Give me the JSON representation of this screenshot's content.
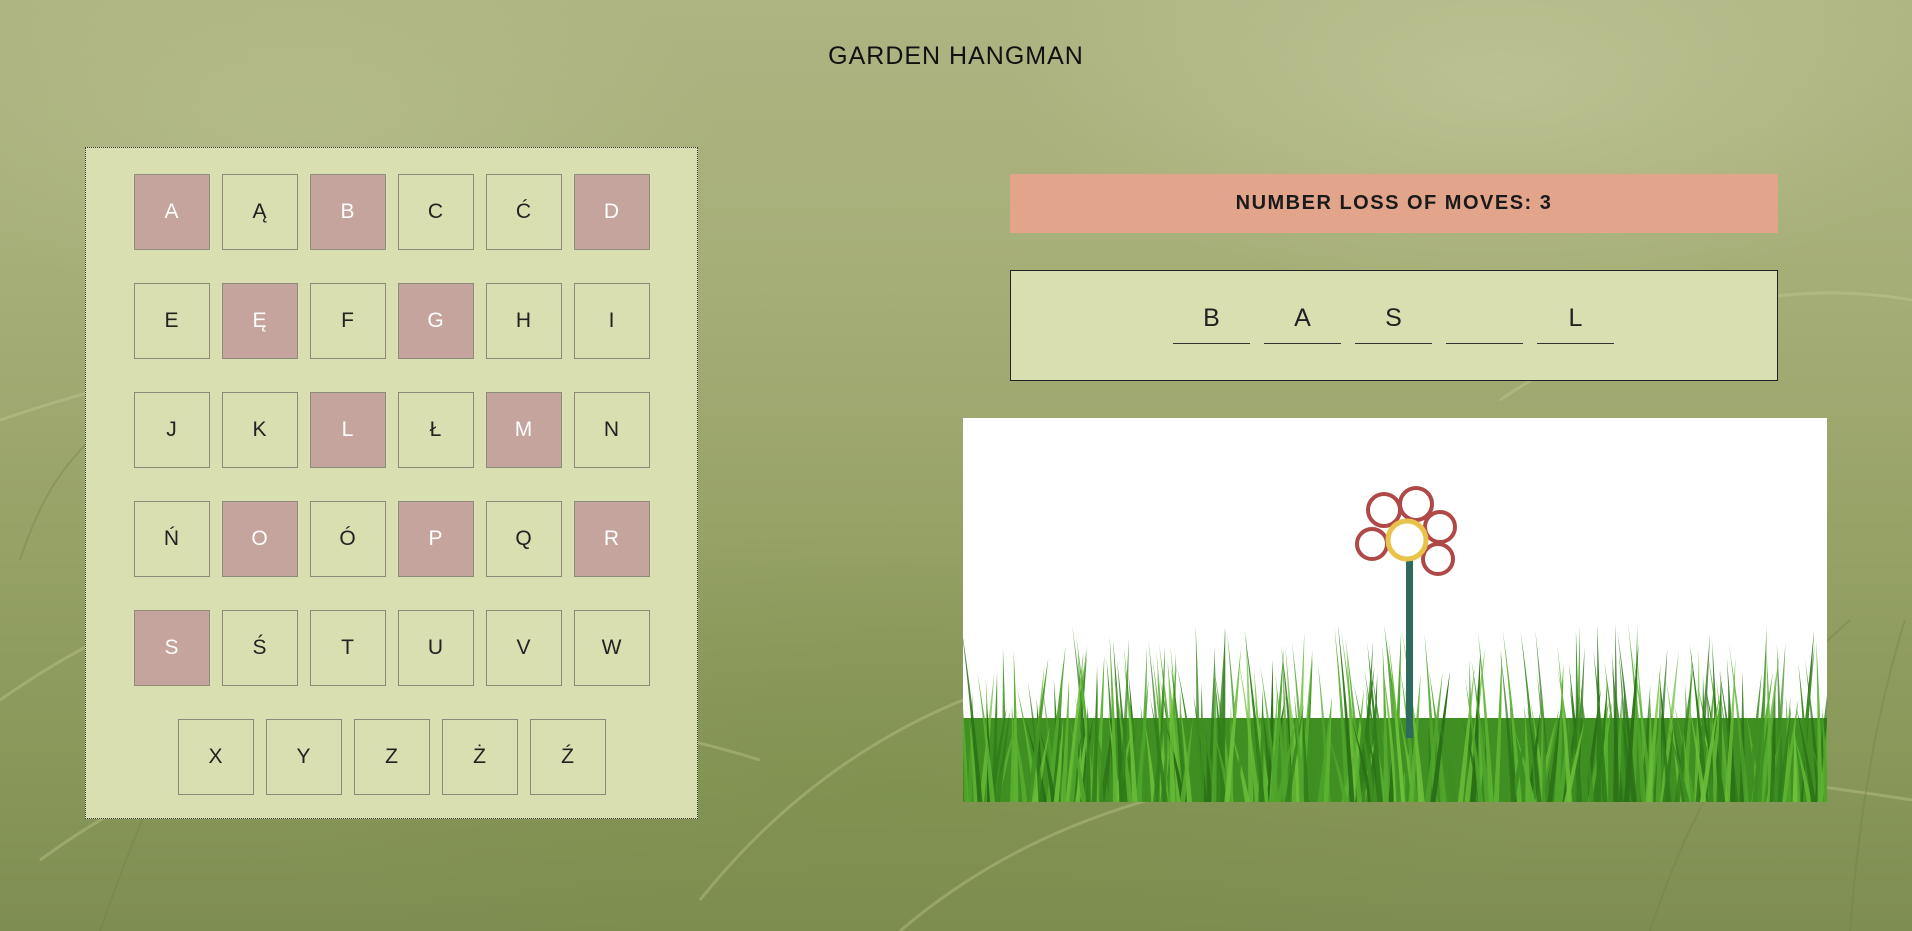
{
  "title": "GARDEN HANGMAN",
  "moves_label": "NUMBER LOSS OF MOVES: 3",
  "keyboard": {
    "rows": [
      [
        {
          "letter": "A",
          "used": true
        },
        {
          "letter": "Ą",
          "used": false
        },
        {
          "letter": "B",
          "used": true
        },
        {
          "letter": "C",
          "used": false
        },
        {
          "letter": "Ć",
          "used": false
        },
        {
          "letter": "D",
          "used": true
        }
      ],
      [
        {
          "letter": "E",
          "used": false
        },
        {
          "letter": "Ę",
          "used": true
        },
        {
          "letter": "F",
          "used": false
        },
        {
          "letter": "G",
          "used": true
        },
        {
          "letter": "H",
          "used": false
        },
        {
          "letter": "I",
          "used": false
        }
      ],
      [
        {
          "letter": "J",
          "used": false
        },
        {
          "letter": "K",
          "used": false
        },
        {
          "letter": "L",
          "used": true
        },
        {
          "letter": "Ł",
          "used": false
        },
        {
          "letter": "M",
          "used": true
        },
        {
          "letter": "N",
          "used": false
        }
      ],
      [
        {
          "letter": "Ń",
          "used": false
        },
        {
          "letter": "O",
          "used": true
        },
        {
          "letter": "Ó",
          "used": false
        },
        {
          "letter": "P",
          "used": true
        },
        {
          "letter": "Q",
          "used": false
        },
        {
          "letter": "R",
          "used": true
        }
      ],
      [
        {
          "letter": "S",
          "used": true
        },
        {
          "letter": "Ś",
          "used": false
        },
        {
          "letter": "T",
          "used": false
        },
        {
          "letter": "U",
          "used": false
        },
        {
          "letter": "V",
          "used": false
        },
        {
          "letter": "W",
          "used": false
        }
      ],
      [
        {
          "letter": "X",
          "used": false
        },
        {
          "letter": "Y",
          "used": false
        },
        {
          "letter": "Z",
          "used": false
        },
        {
          "letter": "Ż",
          "used": false
        },
        {
          "letter": "Ź",
          "used": false
        }
      ]
    ]
  },
  "word_slots": [
    "B",
    "A",
    "S",
    "",
    "L"
  ],
  "colors": {
    "panel": "#d9dfb0",
    "used_key": "#c4a49c",
    "moves_banner": "#e3a48c",
    "petal": "#b04848",
    "flower_center": "#e8c34a",
    "stem": "#2e6b5e",
    "grass": "#4a9a2a"
  },
  "flower": {
    "petals_shown": 6,
    "center_shown": true,
    "stem_shown": true
  }
}
